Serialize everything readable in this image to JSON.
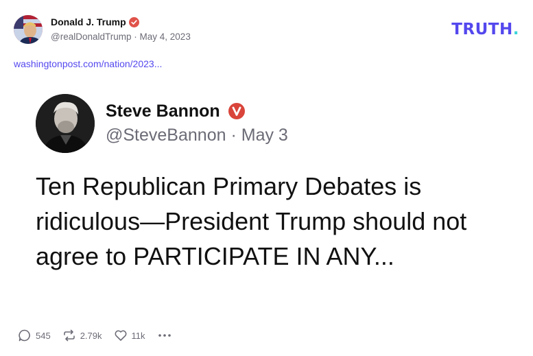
{
  "post": {
    "author_name": "Donald J. Trump",
    "author_handle": "@realDonaldTrump",
    "separator": "·",
    "date": "May 4, 2023",
    "link_text": "washingtonpost.com/nation/2023..."
  },
  "brand": {
    "logo_text": "TRUTH",
    "logo_dot": ".",
    "logo_color": "#5448ee",
    "logo_dot_color": "#3bd5d9"
  },
  "embed": {
    "name": "Steve Bannon",
    "handle": "@SteveBannon",
    "separator": "·",
    "date": "May 3",
    "text": "Ten Republican Primary Debates is ridiculous—President Trump should not agree to PARTICIPATE IN ANY..."
  },
  "actions": {
    "replies": "545",
    "retruths": "2.79k",
    "likes": "11k"
  },
  "icons": {
    "verified": "verified-badge-icon",
    "reply": "reply-icon",
    "retruth": "retruth-icon",
    "like": "heart-icon",
    "more": "more-icon"
  },
  "colors": {
    "verified": "#e0534a",
    "muted": "#6b6b76"
  }
}
